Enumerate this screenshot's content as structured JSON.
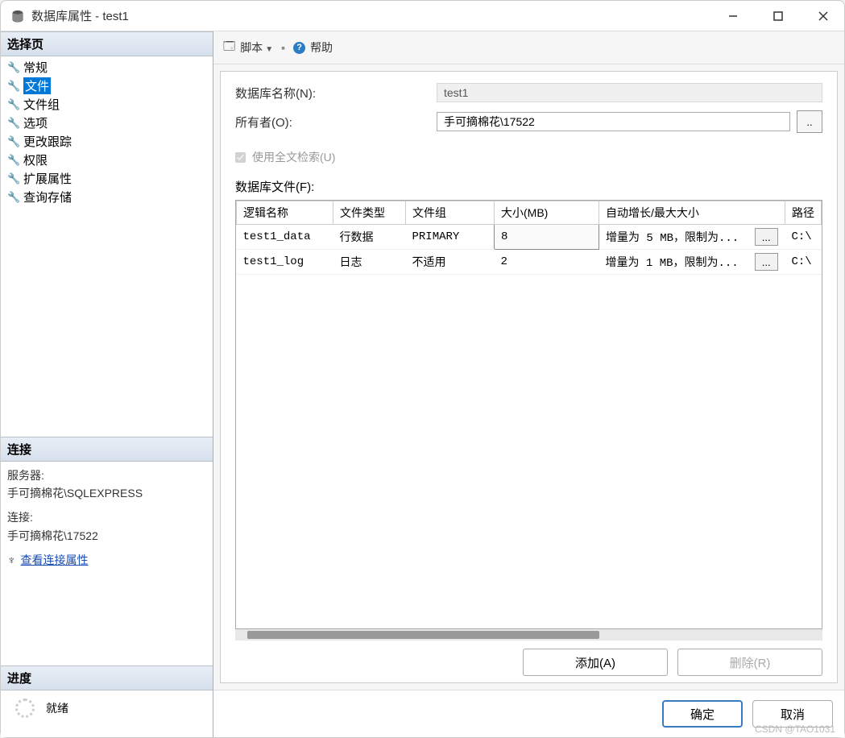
{
  "window": {
    "title": "数据库属性 - test1"
  },
  "sidebar": {
    "select_page": "选择页",
    "items": [
      {
        "label": "常规"
      },
      {
        "label": "文件",
        "selected": true
      },
      {
        "label": "文件组"
      },
      {
        "label": "选项"
      },
      {
        "label": "更改跟踪"
      },
      {
        "label": "权限"
      },
      {
        "label": "扩展属性"
      },
      {
        "label": "查询存储"
      }
    ],
    "connection_header": "连接",
    "server_label": "服务器:",
    "server_value": "手可摘棉花\\SQLEXPRESS",
    "conn_label": "连接:",
    "conn_value": "手可摘棉花\\17522",
    "view_props": "查看连接属性",
    "progress_header": "进度",
    "progress_status": "就绪"
  },
  "toolbar": {
    "script": "脚本",
    "help": "帮助"
  },
  "form": {
    "db_name_label": "数据库名称(N):",
    "db_name_value": "test1",
    "owner_label": "所有者(O):",
    "owner_value": "手可摘棉花\\17522",
    "browse": "..",
    "fulltext_label": "使用全文检索(U)",
    "files_label": "数据库文件(F):"
  },
  "table": {
    "headers": {
      "logical_name": "逻辑名称",
      "file_type": "文件类型",
      "filegroup": "文件组",
      "size": "大小(MB)",
      "autogrow": "自动增长/最大大小",
      "path": "路径"
    },
    "rows": [
      {
        "logical_name": "test1_data",
        "file_type": "行数据",
        "filegroup": "PRIMARY",
        "size": "8",
        "autogrow": "增量为 5 MB，限制为...",
        "btn": "...",
        "path": "C:\\"
      },
      {
        "logical_name": "test1_log",
        "file_type": "日志",
        "filegroup": "不适用",
        "size": "2",
        "autogrow": "增量为 1 MB，限制为...",
        "btn": "...",
        "path": "C:\\"
      }
    ]
  },
  "actions": {
    "add": "添加(A)",
    "remove": "删除(R)"
  },
  "dialog": {
    "ok": "确定",
    "cancel": "取消"
  },
  "watermark": "CSDN @TAO1031"
}
